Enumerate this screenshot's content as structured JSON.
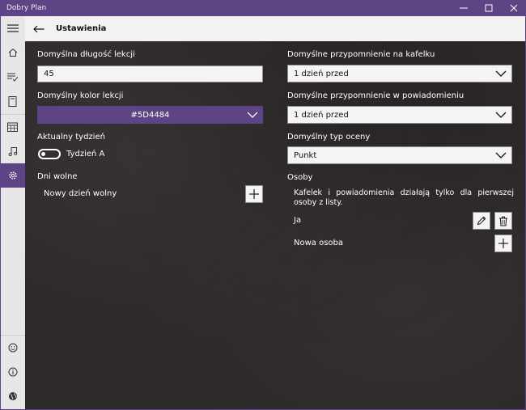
{
  "window": {
    "title": "Dobry Plan",
    "controls": [
      "minimize",
      "maximize",
      "close"
    ]
  },
  "nav": {
    "items": [
      {
        "icon": "menu-icon"
      },
      {
        "icon": "home-icon"
      },
      {
        "icon": "tasks-icon"
      },
      {
        "icon": "book-icon"
      },
      {
        "icon": "calendar-icon"
      },
      {
        "icon": "music-icon"
      },
      {
        "icon": "settings-icon",
        "active": true
      },
      {
        "icon": "smiley-icon"
      },
      {
        "icon": "info-icon"
      },
      {
        "icon": "globe-icon"
      }
    ]
  },
  "header": {
    "title": "Ustawienia"
  },
  "left": {
    "lesson_length_label": "Domyślna długość lekcji",
    "lesson_length_value": "45",
    "lesson_color_label": "Domyślny kolor lekcji",
    "lesson_color_value": "#5D4484",
    "current_week_label": "Aktualny tydzień",
    "current_week_value": "Tydzień A",
    "days_off_label": "Dni wolne",
    "new_day_off_label": "Nowy dzień wolny"
  },
  "right": {
    "tile_reminder_label": "Domyślne przypomnienie na kafelku",
    "tile_reminder_value": "1 dzień przed",
    "notification_reminder_label": "Domyślne przypomnienie w powiadomieniu",
    "notification_reminder_value": "1 dzień przed",
    "grade_type_label": "Domyślny typ oceny",
    "grade_type_value": "Punkt",
    "people_label": "Osoby",
    "people_note": "Kafelek i powiadomienia działają tylko dla pierwszej osoby z listy.",
    "person_name": "Ja",
    "new_person_label": "Nowa osoba"
  },
  "colors": {
    "accent": "#5D4484",
    "background": "#2D2829",
    "nav_background": "#E7E7E7"
  }
}
